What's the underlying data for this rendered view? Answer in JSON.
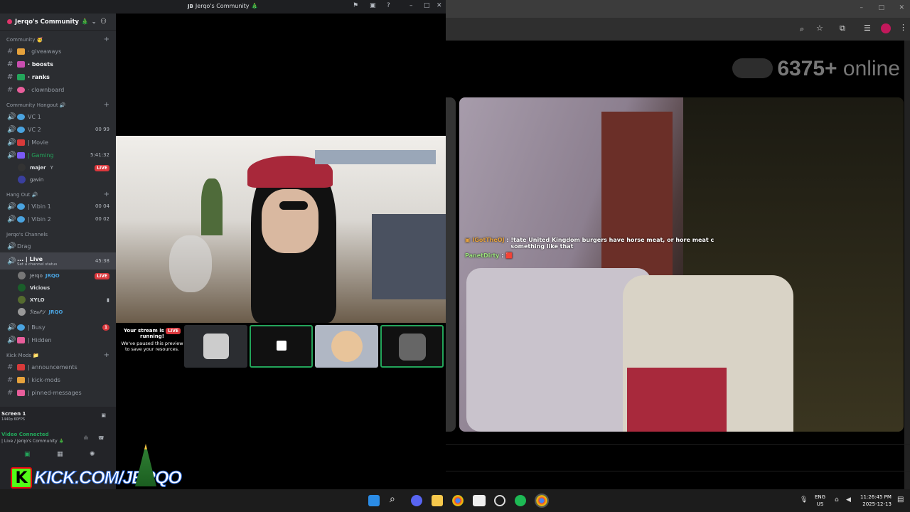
{
  "discord": {
    "window_title": "Jerqo's Community 🎄",
    "server_name": "Jerqo's Community 🎄",
    "categories": [
      {
        "name": "Community 🥳",
        "channels": [
          {
            "label": "· giveaways",
            "style": "normal"
          },
          {
            "label": "· boosts",
            "style": "bold"
          },
          {
            "label": "· ranks",
            "style": "bold"
          },
          {
            "label": "· clownboard",
            "style": "normal"
          }
        ]
      },
      {
        "name": "Community Hangout 🔊",
        "channels": [
          {
            "label": "VC 1",
            "type": "voice"
          },
          {
            "label": "VC 2",
            "type": "voice",
            "right": "00 99"
          },
          {
            "label": "| Movie",
            "type": "voice"
          },
          {
            "label": "| Gaming",
            "type": "voice",
            "right": "5:41:32",
            "active": true
          }
        ]
      },
      {
        "name": "Hang Out 🔊",
        "channels": [
          {
            "label": "| Vibin 1",
            "type": "voice",
            "right": "00 04"
          },
          {
            "label": "| Vibin 2",
            "type": "voice",
            "right": "00 02"
          }
        ]
      },
      {
        "name": "Jerqo's Channels",
        "channels": [
          {
            "label": "Drag",
            "type": "voice"
          },
          {
            "label": "... | Live",
            "type": "voice",
            "right": "45:38",
            "selected": true,
            "status": "Set a channel status"
          }
        ]
      }
    ],
    "gaming_users": [
      {
        "name": "majer",
        "badge": "LIVE"
      },
      {
        "name": "gavin"
      }
    ],
    "live_users": [
      {
        "name": "Jerqo",
        "tag": "JRQO",
        "badge": "LIVE"
      },
      {
        "name": "Vicious"
      },
      {
        "name": "XYLO"
      },
      {
        "name": "ℛ𝑒𝒶𝓁ツ",
        "tag": "JRQO"
      }
    ],
    "more_channels": [
      {
        "label": "| Busy",
        "type": "voice",
        "right": "1"
      },
      {
        "label": "| Hidden",
        "type": "voice"
      }
    ],
    "kick_mods": {
      "name": "Kick Mods 📁",
      "channels": [
        "| announcements",
        "| kick-mods",
        "| pinned-messages"
      ]
    },
    "panel": {
      "screen": "Screen 1",
      "quality": "1440p 60FPS",
      "status": "Video Connected",
      "location": "| Live / Jerqo's Community 🎄"
    },
    "paused": {
      "title": "Your stream is",
      "badge": "LIVE",
      "title2": "running!",
      "sub": "We've paused this preview to save your resources."
    }
  },
  "browser": {
    "online_count": "6375+",
    "online_label": "online"
  },
  "chat": [
    {
      "user": "IGotTheOJ",
      "text": "!tate United Kingdom burgers have horse meat, or hore meat c something like that"
    },
    {
      "user": "PanetDirty",
      "text": "🟥"
    }
  ],
  "overlay": {
    "kick_url": "KICK.COM/JERQO",
    "kick_letter": "K"
  },
  "taskbar": {
    "lang": "ENG",
    "region": "US",
    "time": "11:26:45 PM",
    "date": "2025-12-13"
  }
}
